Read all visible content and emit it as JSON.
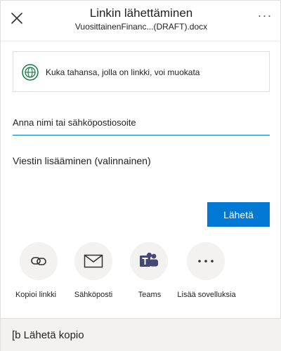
{
  "header": {
    "title": "Linkin lähettäminen",
    "filename": "VuosittainenFinanc...(DRAFT).docx",
    "more_label": "···"
  },
  "permission": {
    "text": "Kuka tahansa, jolla on linkki, voi muokata"
  },
  "recipient": {
    "placeholder": "Anna nimi tai sähköpostiosoite"
  },
  "message": {
    "placeholder": "Viestin lisääminen (valinnainen)"
  },
  "send_label": "Lähetä",
  "share_options": [
    {
      "label": "Kopioi linkki",
      "icon": "link-icon"
    },
    {
      "label": "Sähköposti",
      "icon": "mail-icon"
    },
    {
      "label": "Teams",
      "icon": "teams-icon"
    },
    {
      "label": "Lisää sovelluksia",
      "icon": "more-icon"
    }
  ],
  "footer": {
    "label": "[b Lähetä kopio"
  },
  "colors": {
    "accent": "#0078d4",
    "globe": "#107c41",
    "teams": "#464775"
  }
}
